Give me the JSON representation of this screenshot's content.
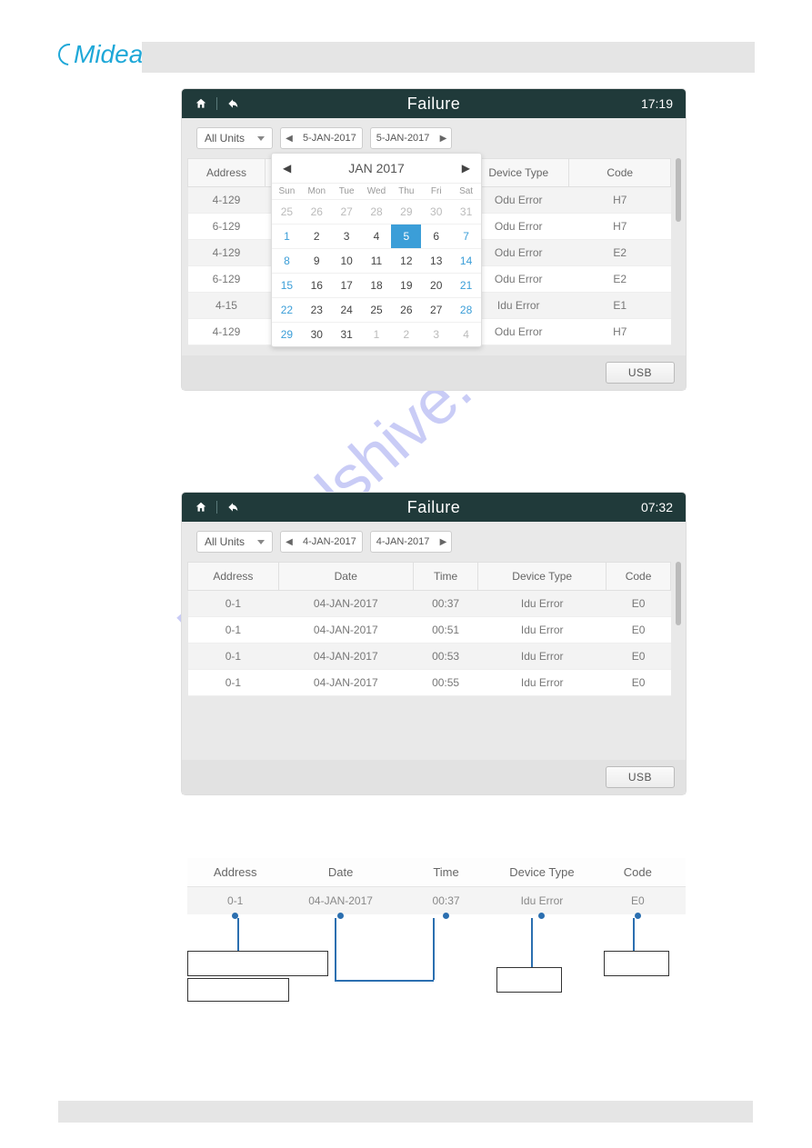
{
  "brand": "Midea",
  "watermark": "manualshive.com",
  "panel1": {
    "title": "Failure",
    "time": "17:19",
    "filter": "All Units",
    "date_from": "5-JAN-2017",
    "date_to": "5-JAN-2017",
    "usb_label": "USB",
    "columns": [
      "Address",
      "Device Type",
      "Code"
    ],
    "rows": [
      {
        "address": "4-129",
        "device": "Odu Error",
        "code": "H7"
      },
      {
        "address": "6-129",
        "device": "Odu Error",
        "code": "H7"
      },
      {
        "address": "4-129",
        "device": "Odu Error",
        "code": "E2"
      },
      {
        "address": "6-129",
        "device": "Odu Error",
        "code": "E2"
      },
      {
        "address": "4-15",
        "device": "Idu Error",
        "code": "E1"
      },
      {
        "address": "4-129",
        "device": "Odu Error",
        "code": "H7"
      }
    ],
    "calendar": {
      "title": "JAN 2017",
      "dow": [
        "Sun",
        "Mon",
        "Tue",
        "Wed",
        "Thu",
        "Fri",
        "Sat"
      ],
      "weeks": [
        [
          {
            "n": "25",
            "o": true
          },
          {
            "n": "26",
            "o": true
          },
          {
            "n": "27",
            "o": true
          },
          {
            "n": "28",
            "o": true
          },
          {
            "n": "29",
            "o": true
          },
          {
            "n": "30",
            "o": true
          },
          {
            "n": "31",
            "o": true
          }
        ],
        [
          {
            "n": "1",
            "w": true
          },
          {
            "n": "2"
          },
          {
            "n": "3"
          },
          {
            "n": "4"
          },
          {
            "n": "5",
            "sel": true
          },
          {
            "n": "6"
          },
          {
            "n": "7",
            "w": true
          }
        ],
        [
          {
            "n": "8",
            "w": true
          },
          {
            "n": "9"
          },
          {
            "n": "10"
          },
          {
            "n": "11"
          },
          {
            "n": "12"
          },
          {
            "n": "13"
          },
          {
            "n": "14",
            "w": true
          }
        ],
        [
          {
            "n": "15",
            "w": true
          },
          {
            "n": "16"
          },
          {
            "n": "17"
          },
          {
            "n": "18"
          },
          {
            "n": "19"
          },
          {
            "n": "20"
          },
          {
            "n": "21",
            "w": true
          }
        ],
        [
          {
            "n": "22",
            "w": true
          },
          {
            "n": "23"
          },
          {
            "n": "24"
          },
          {
            "n": "25"
          },
          {
            "n": "26"
          },
          {
            "n": "27"
          },
          {
            "n": "28",
            "w": true
          }
        ],
        [
          {
            "n": "29",
            "w": true
          },
          {
            "n": "30"
          },
          {
            "n": "31"
          },
          {
            "n": "1",
            "o": true
          },
          {
            "n": "2",
            "o": true
          },
          {
            "n": "3",
            "o": true
          },
          {
            "n": "4",
            "o": true
          }
        ]
      ]
    }
  },
  "panel2": {
    "title": "Failure",
    "time": "07:32",
    "filter": "All Units",
    "date_from": "4-JAN-2017",
    "date_to": "4-JAN-2017",
    "usb_label": "USB",
    "columns": [
      "Address",
      "Date",
      "Time",
      "Device Type",
      "Code"
    ],
    "rows": [
      {
        "address": "0-1",
        "date": "04-JAN-2017",
        "time": "00:37",
        "device": "Idu Error",
        "code": "E0"
      },
      {
        "address": "0-1",
        "date": "04-JAN-2017",
        "time": "00:51",
        "device": "Idu Error",
        "code": "E0"
      },
      {
        "address": "0-1",
        "date": "04-JAN-2017",
        "time": "00:53",
        "device": "Idu Error",
        "code": "E0"
      },
      {
        "address": "0-1",
        "date": "04-JAN-2017",
        "time": "00:55",
        "device": "Idu Error",
        "code": "E0"
      }
    ]
  },
  "explainer": {
    "columns": [
      "Address",
      "Date",
      "Time",
      "Device Type",
      "Code"
    ],
    "row": {
      "address": "0-1",
      "date": "04-JAN-2017",
      "time": "00:37",
      "device": "Idu Error",
      "code": "E0"
    }
  }
}
